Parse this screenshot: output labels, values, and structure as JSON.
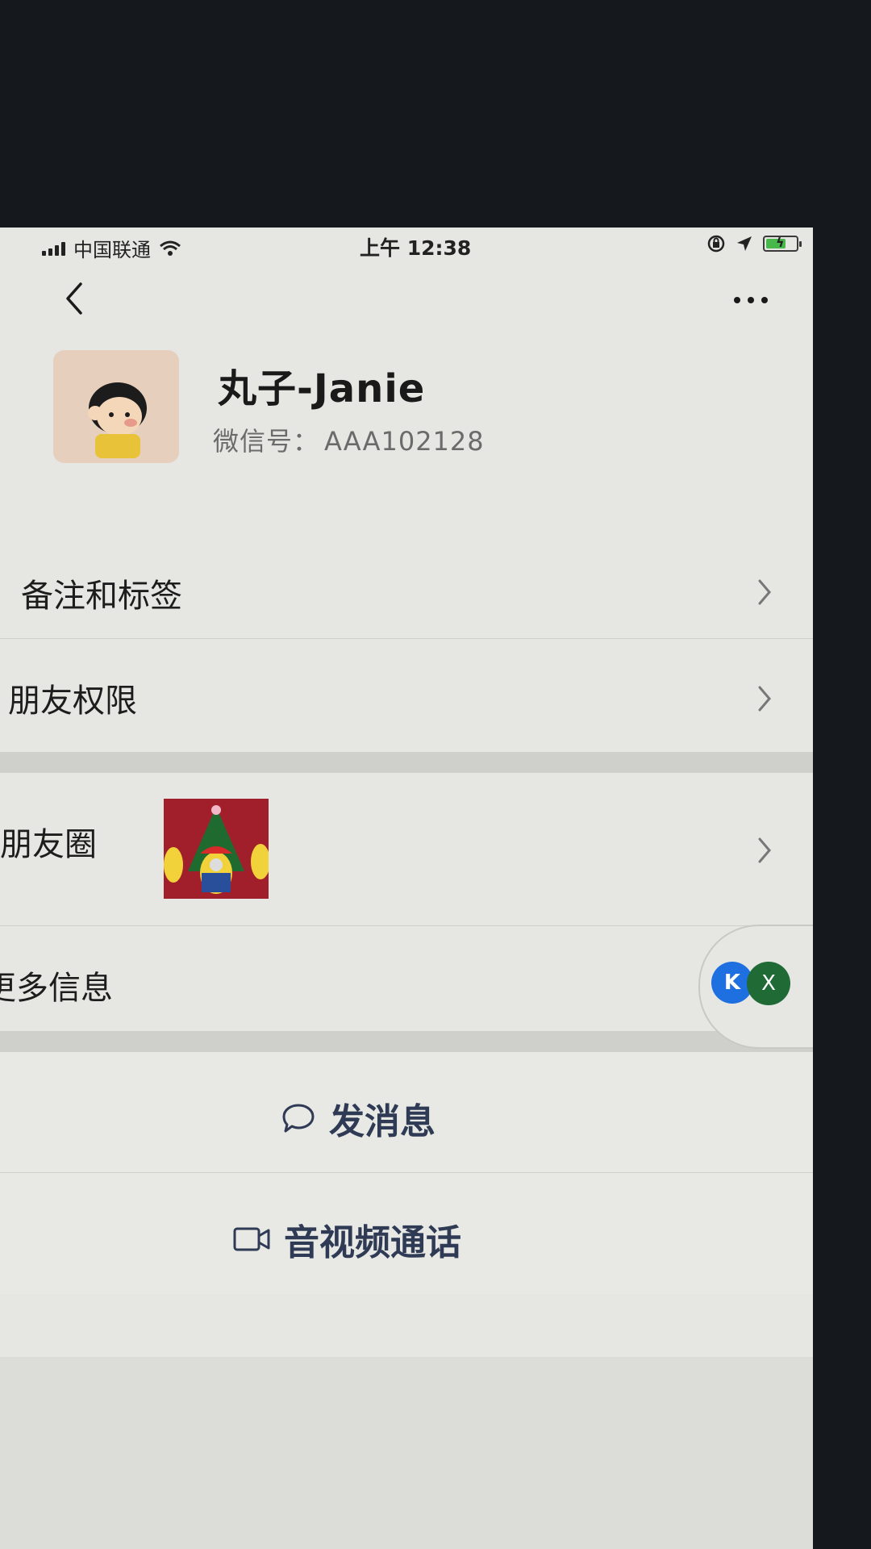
{
  "status_bar": {
    "carrier": "中国联通",
    "time": "上午 12:38"
  },
  "profile": {
    "name": "丸子-Janie",
    "wechat_id_label": "微信号：",
    "wechat_id": "AAA102128"
  },
  "menu": {
    "remarks_tags": "备注和标签",
    "friend_permissions": "朋友权限",
    "moments": "朋友圈",
    "more_info": "更多信息"
  },
  "floating": {
    "k_icon_label": "K",
    "x_icon_label": "X"
  },
  "actions": {
    "send_message": "发消息",
    "video_call": "音视频通话"
  },
  "colors": {
    "background": "#e6e7e3",
    "separator": "#cfd0cc",
    "action_text": "#2f3a55"
  }
}
